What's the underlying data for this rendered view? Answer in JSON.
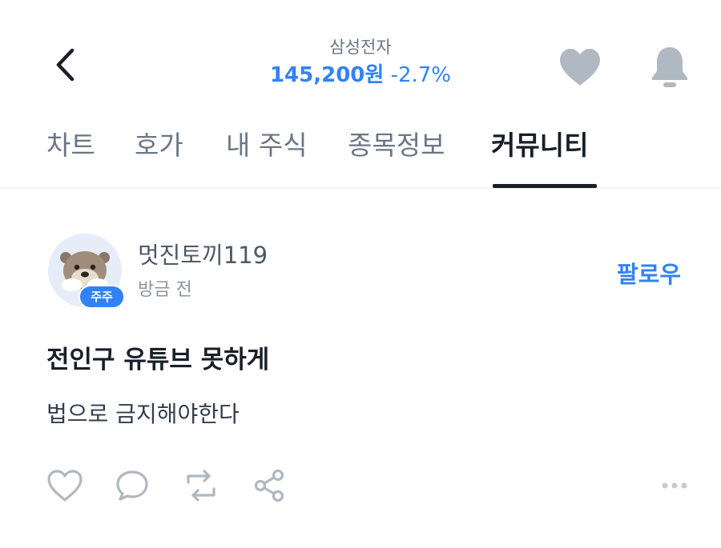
{
  "header": {
    "stock_name": "삼성전자",
    "price": "145,200원",
    "change": "-2.7%",
    "accent_color": "#3182f6",
    "icons": [
      "chevron-left-icon",
      "heart-icon",
      "bell-icon"
    ]
  },
  "tabs": [
    {
      "label": "차트",
      "active": false
    },
    {
      "label": "호가",
      "active": false
    },
    {
      "label": "내 주식",
      "active": false
    },
    {
      "label": "종목정보",
      "active": false
    },
    {
      "label": "커뮤니티",
      "active": true
    }
  ],
  "post": {
    "author": "멋진토끼119",
    "badge": "주주",
    "time": "방금 전",
    "follow_label": "팔로우",
    "title": "전인구 유튜브 못하게",
    "body": "법으로 금지해야한다",
    "actions": [
      "heart-icon",
      "comment-icon",
      "repost-icon",
      "share-icon",
      "more-icon"
    ]
  }
}
